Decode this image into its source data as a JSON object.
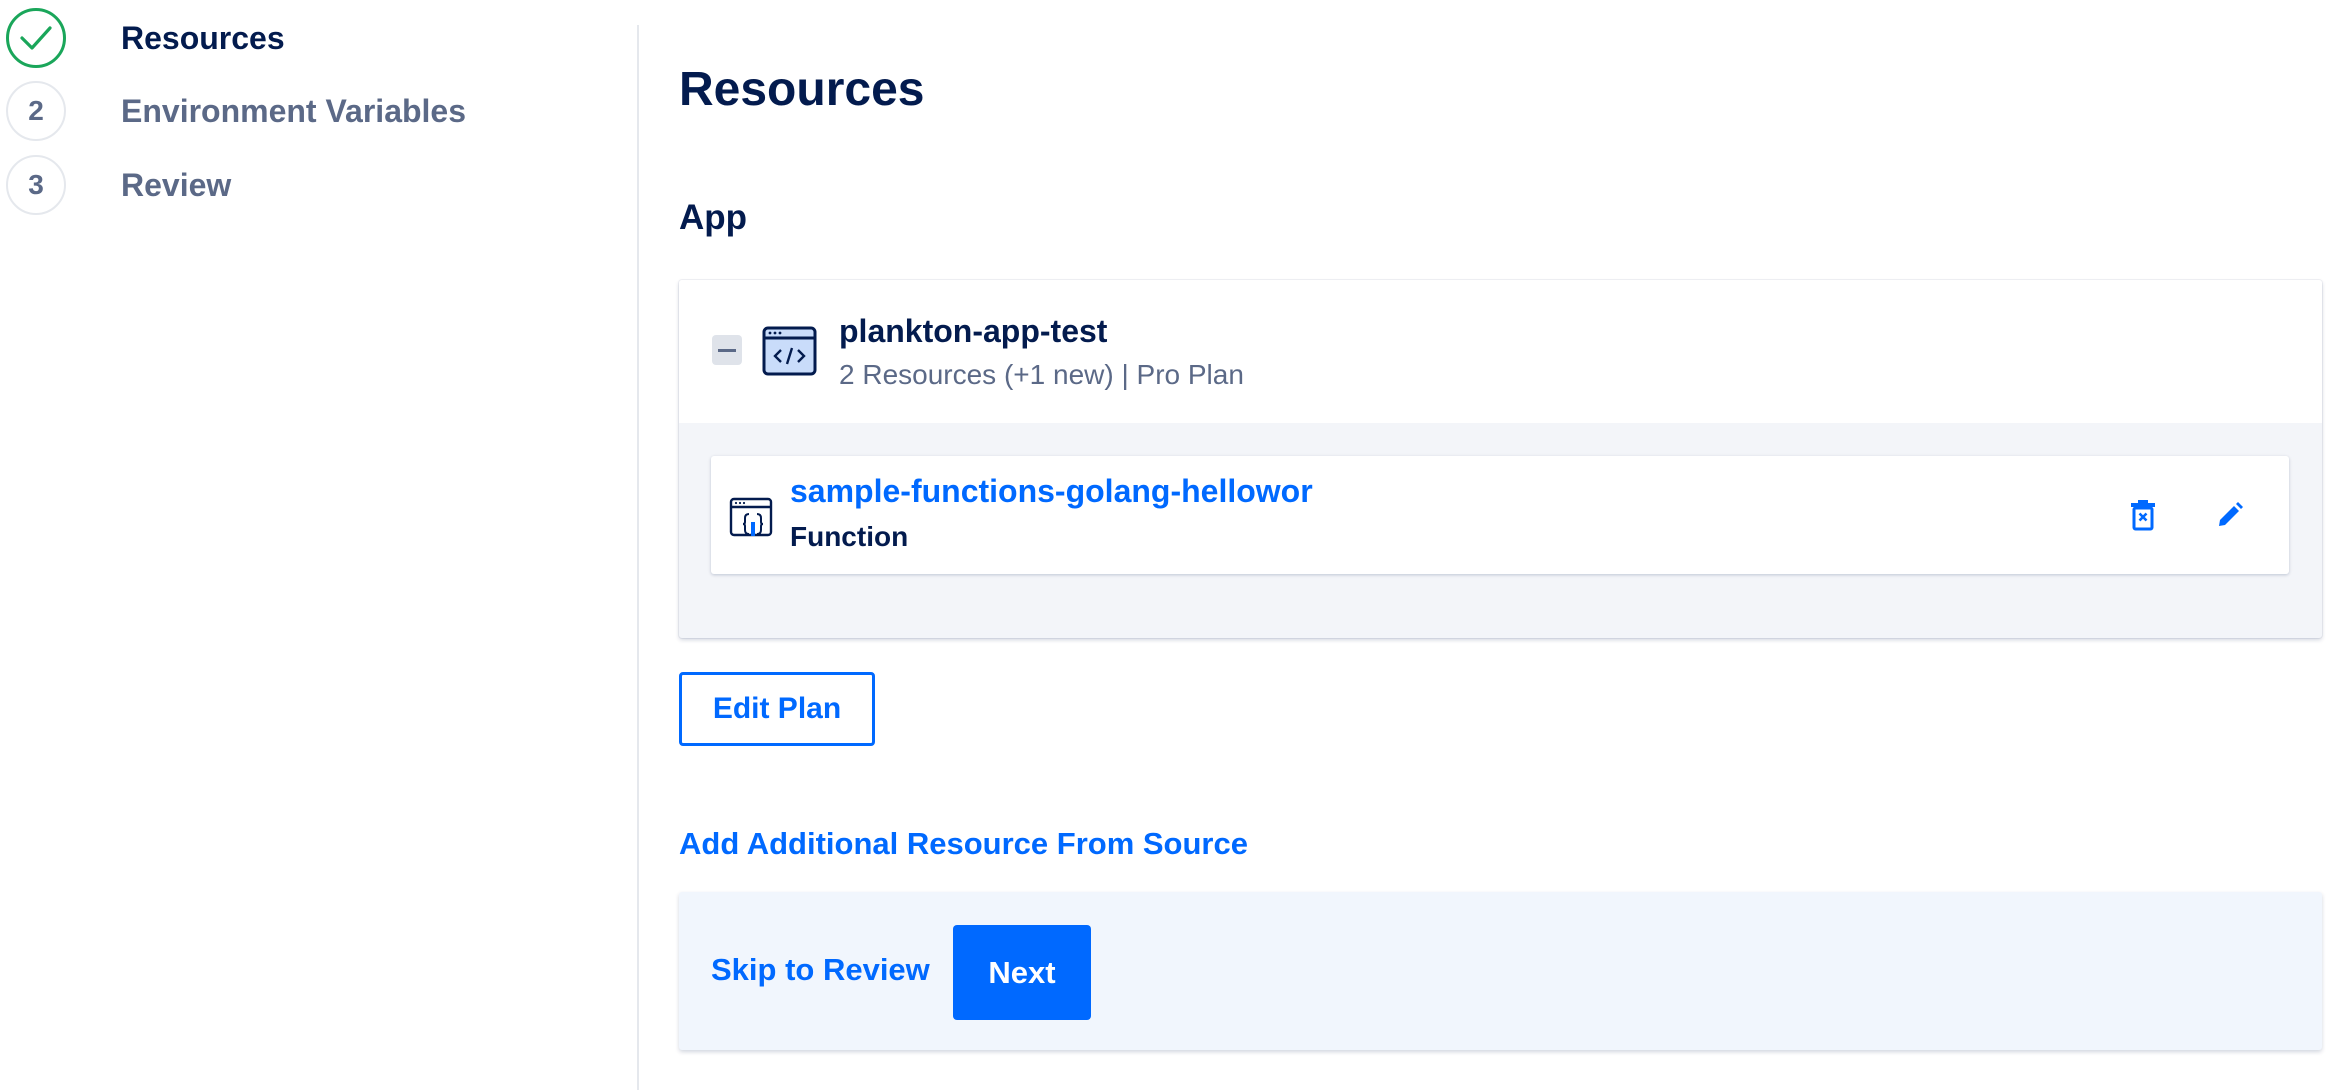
{
  "stepper": {
    "steps": [
      {
        "label": "Resources",
        "number": "",
        "status": "completed"
      },
      {
        "label": "Environment Variables",
        "number": "2",
        "status": "pending"
      },
      {
        "label": "Review",
        "number": "3",
        "status": "pending"
      }
    ]
  },
  "main": {
    "title": "Resources",
    "section_title": "App",
    "app": {
      "name": "plankton-app-test",
      "meta": "2 Resources (+1 new) | Pro Plan",
      "resources": [
        {
          "name": "sample-functions-golang-hellowor",
          "type": "Function"
        }
      ]
    },
    "edit_plan_label": "Edit Plan",
    "add_resource_label": "Add Additional Resource From Source",
    "footer": {
      "skip_label": "Skip to Review",
      "next_label": "Next"
    }
  },
  "colors": {
    "accent": "#0069ff",
    "text": "#031b4e",
    "muted": "#5b6987",
    "success": "#1aa65a"
  }
}
